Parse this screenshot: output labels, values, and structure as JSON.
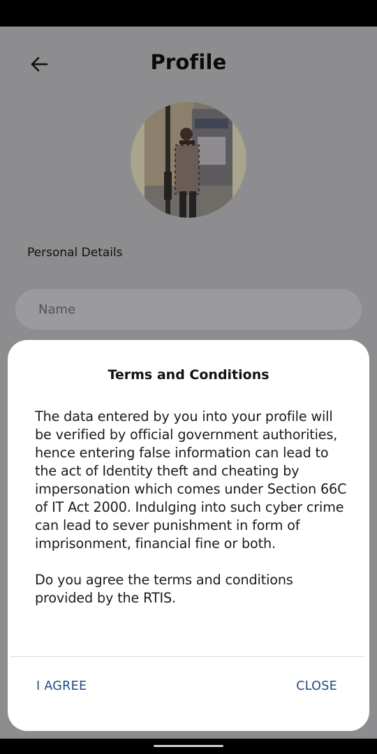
{
  "header": {
    "title": "Profile",
    "back_icon": "arrow-left-icon"
  },
  "profile": {
    "section_label": "Personal Details",
    "name_placeholder": "Name"
  },
  "dialog": {
    "title": "Terms and Conditions",
    "body": "The data entered by you into your profile will be verified by official government authorities, hence entering false information can lead to the act of Identity theft and cheating by impersonation which comes under Section 66C of IT Act 2000. Indulging into such cyber crime can lead to sever punishment in form of imprisonment, financial fine or both.\n\nDo you agree the terms and conditions provided by the RTIS.",
    "agree_label": "I AGREE",
    "close_label": "CLOSE"
  },
  "colors": {
    "scrim": "#8d8d8f",
    "button_text": "#1f4a86",
    "dialog_bg": "#ffffff"
  }
}
